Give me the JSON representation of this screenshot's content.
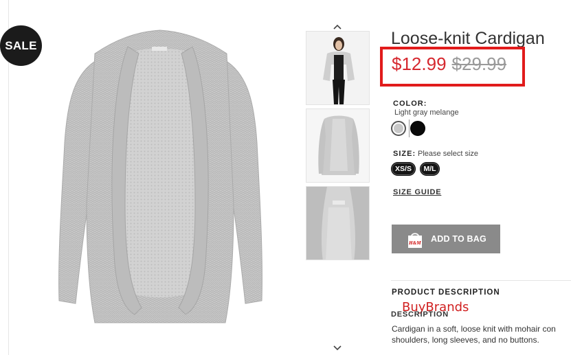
{
  "sale_badge": "SALE",
  "product": {
    "title": "Loose-knit Cardigan",
    "sale_price": "$12.99",
    "original_price": "$29.99"
  },
  "color": {
    "label": "COLOR:",
    "selected": "Light gray melange",
    "swatches": [
      {
        "name": "light-gray",
        "hex": "#c8c8c8"
      },
      {
        "name": "black",
        "hex": "#0a0a0a"
      }
    ]
  },
  "size": {
    "label": "SIZE:",
    "hint": "Please select size",
    "options": [
      "XS/S",
      "M/L"
    ]
  },
  "size_guide": "SIZE GUIDE",
  "add_to_bag": "ADD TO BAG",
  "bag_icon_text": "H&M",
  "product_description_heading": "PRODUCT DESCRIPTION",
  "watermark": "BuyBrands",
  "description": {
    "heading": "DESCRIPTION",
    "lines": [
      "Cardigan in a soft, loose knit with mohair con",
      "shoulders, long sleeves, and no buttons."
    ]
  },
  "colors": {
    "sale_red": "#d6282f",
    "highlight_red": "#e11b1b",
    "button_gray": "#8a8a8a"
  }
}
